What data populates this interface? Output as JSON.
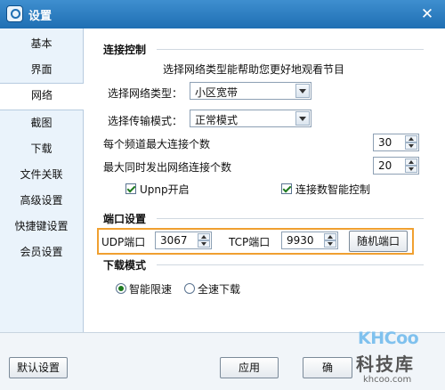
{
  "window": {
    "title": "设置"
  },
  "sidebar": {
    "items": [
      {
        "label": "基本"
      },
      {
        "label": "界面"
      },
      {
        "label": "网络"
      },
      {
        "label": "截图"
      },
      {
        "label": "下载"
      },
      {
        "label": "文件关联"
      },
      {
        "label": "高级设置"
      },
      {
        "label": "快捷键设置"
      },
      {
        "label": "会员设置"
      }
    ],
    "active": "网络"
  },
  "connection": {
    "section_title": "连接控制",
    "hint": "选择网络类型能帮助您更好地观看节目",
    "network_type_label": "选择网络类型：",
    "network_type_value": "小区宽带",
    "transfer_mode_label": "选择传输模式：",
    "transfer_mode_value": "正常模式",
    "max_conn_per_channel_label": "每个频道最大连接个数",
    "max_conn_per_channel_value": "30",
    "max_concurrent_label": "最大同时发出网络连接个数",
    "max_concurrent_value": "20",
    "upnp_label": "Upnp开启",
    "upnp_checked": true,
    "smart_conn_label": "连接数智能控制",
    "smart_conn_checked": true
  },
  "ports": {
    "section_title": "端口设置",
    "udp_label": "UDP端口",
    "udp_value": "3067",
    "tcp_label": "TCP端口",
    "tcp_value": "9930",
    "random_button": "随机端口"
  },
  "download": {
    "section_title": "下载模式",
    "options": [
      {
        "label": "智能限速",
        "selected": true
      },
      {
        "label": "全速下载",
        "selected": false
      }
    ]
  },
  "footer": {
    "default_button": "默认设置",
    "apply_button": "应用",
    "ok_button_partial": "确"
  },
  "watermark": {
    "logo": "KHCoo",
    "name": "科技库",
    "url": "khcoo.com"
  },
  "colors": {
    "titlebar": "#2a7cc0",
    "sidebar_bg": "#eaf3fb",
    "highlight_border": "#f0a030",
    "check_color": "#1e7a1e"
  }
}
